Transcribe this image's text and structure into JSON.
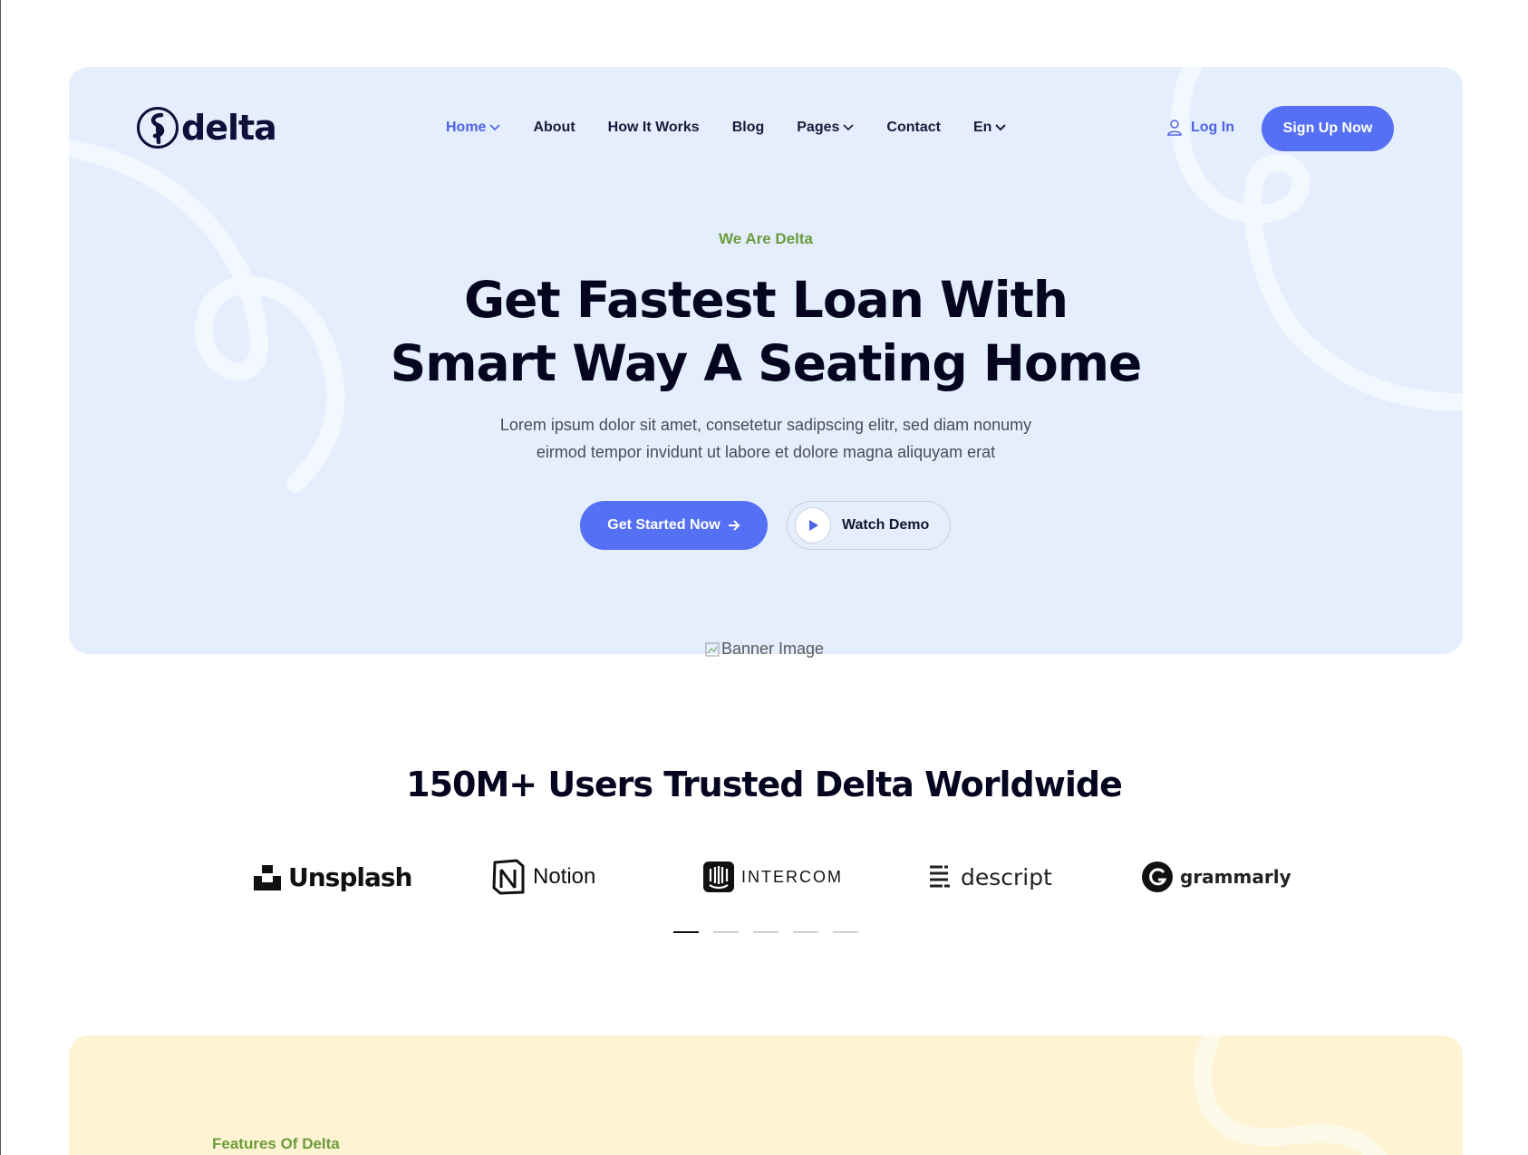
{
  "brand": {
    "name": "delta"
  },
  "nav": {
    "items": [
      {
        "label": "Home",
        "dropdown": true,
        "active": true
      },
      {
        "label": "About",
        "dropdown": false,
        "active": false
      },
      {
        "label": "How It Works",
        "dropdown": false,
        "active": false
      },
      {
        "label": "Blog",
        "dropdown": false,
        "active": false
      },
      {
        "label": "Pages",
        "dropdown": true,
        "active": false
      },
      {
        "label": "Contact",
        "dropdown": false,
        "active": false
      }
    ],
    "language": "En",
    "login_label": "Log In",
    "signup_label": "Sign Up Now"
  },
  "hero": {
    "eyebrow": "We Are Delta",
    "headline_line1": "Get Fastest Loan With",
    "headline_line2": "Smart Way A Seating Home",
    "lead_line1": "Lorem ipsum dolor sit amet, consetetur sadipscing elitr, sed diam nonumy",
    "lead_line2": "eirmod tempor invidunt ut labore et dolore magna aliquyam erat",
    "primary_cta": "Get Started Now",
    "secondary_cta": "Watch Demo",
    "banner_alt": "Banner Image"
  },
  "trusted": {
    "title": "150M+ Users Trusted Delta Worldwide",
    "brands": [
      "Unsplash",
      "Notion",
      "INTERCOM",
      "descript",
      "grammarly"
    ],
    "slider_pages": 5,
    "active_page": 1
  },
  "features": {
    "eyebrow": "Features Of Delta"
  },
  "colors": {
    "accent": "#5570f4",
    "eyebrow_green": "#6c9b3d",
    "hero_bg": "#e4eefd",
    "features_bg": "#fef3d2",
    "heading": "#05051f"
  }
}
